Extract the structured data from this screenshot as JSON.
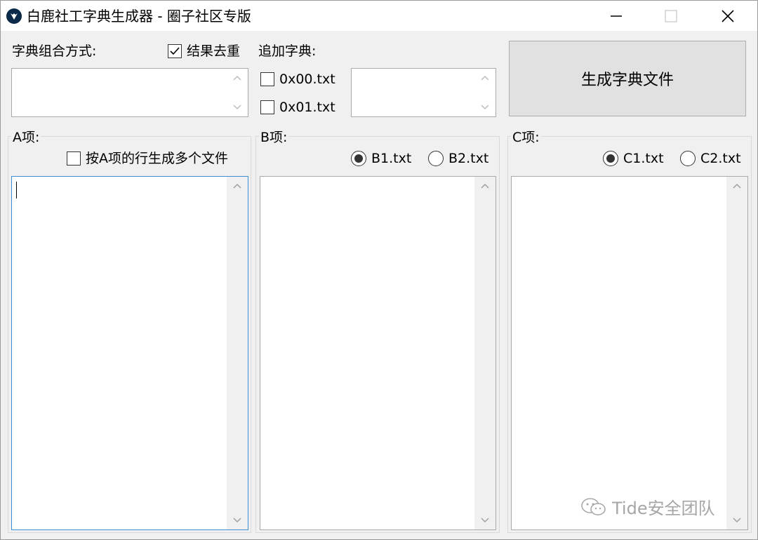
{
  "window": {
    "title": "白鹿社工字典生成器 - 圈子社区专版",
    "icon": "deer-logo-icon",
    "controls": [
      "minimize-icon",
      "maximize-icon",
      "close-icon"
    ]
  },
  "top": {
    "combo_label": "字典组合方式:",
    "dedupe_label": "结果去重",
    "dedupe_checked": true,
    "append_label": "追加字典:",
    "append_options": [
      {
        "label": "0x00.txt",
        "checked": false
      },
      {
        "label": "0x01.txt",
        "checked": false
      }
    ],
    "generate_button": "生成字典文件"
  },
  "groups": {
    "a": {
      "title": "A项:",
      "multi_file_label": "按A项的行生成多个文件",
      "multi_file_checked": false
    },
    "b": {
      "title": "B项:",
      "options": [
        {
          "label": "B1.txt",
          "selected": true
        },
        {
          "label": "B2.txt",
          "selected": false
        }
      ]
    },
    "c": {
      "title": "C项:",
      "options": [
        {
          "label": "C1.txt",
          "selected": true
        },
        {
          "label": "C2.txt",
          "selected": false
        }
      ]
    }
  },
  "watermark": {
    "text": "Tide安全团队",
    "icon": "wechat-icon"
  },
  "colors": {
    "window_bg": "#f0f0f0",
    "button_bg": "#e1e1e1",
    "focus_border": "#3c8ed8"
  }
}
